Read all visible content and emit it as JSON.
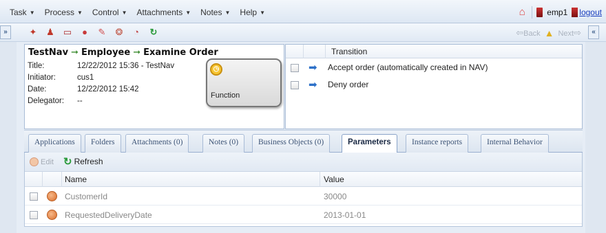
{
  "menu": {
    "items": [
      {
        "label": "Task"
      },
      {
        "label": "Process"
      },
      {
        "label": "Control"
      },
      {
        "label": "Attachments"
      },
      {
        "label": "Notes"
      },
      {
        "label": "Help"
      }
    ]
  },
  "user": {
    "name": "emp1",
    "logout": "logout"
  },
  "toolbar": {
    "expand_left": "»",
    "expand_right": "«",
    "back_label": "Back",
    "next_label": "Next"
  },
  "breadcrumb": {
    "parts": [
      "TestNav",
      "Employee",
      "Examine Order"
    ]
  },
  "info": {
    "title_label": "Title:",
    "title_value": "12/22/2012 15:36 - TestNav",
    "initiator_label": "Initiator:",
    "initiator_value": "cus1",
    "date_label": "Date:",
    "date_value": "12/22/2012 15:42",
    "delegator_label": "Delegator:",
    "delegator_value": "--",
    "function_label": "Function"
  },
  "transitions": {
    "header": "Transition",
    "rows": [
      {
        "label": "Accept order (automatically created in NAV)"
      },
      {
        "label": "Deny order"
      }
    ]
  },
  "tabs": [
    {
      "label": "Applications"
    },
    {
      "label": "Folders"
    },
    {
      "label": "Attachments (0)"
    },
    {
      "label": "Notes (0)"
    },
    {
      "label": "Business Objects (0)"
    },
    {
      "label": "Parameters"
    },
    {
      "label": "Instance reports"
    },
    {
      "label": "Internal Behavior"
    }
  ],
  "params": {
    "edit_label": "Edit",
    "refresh_label": "Refresh",
    "col_name": "Name",
    "col_value": "Value",
    "rows": [
      {
        "name": "CustomerId",
        "value": "30000"
      },
      {
        "name": "RequestedDeliveryDate",
        "value": "2013-01-01"
      }
    ]
  }
}
